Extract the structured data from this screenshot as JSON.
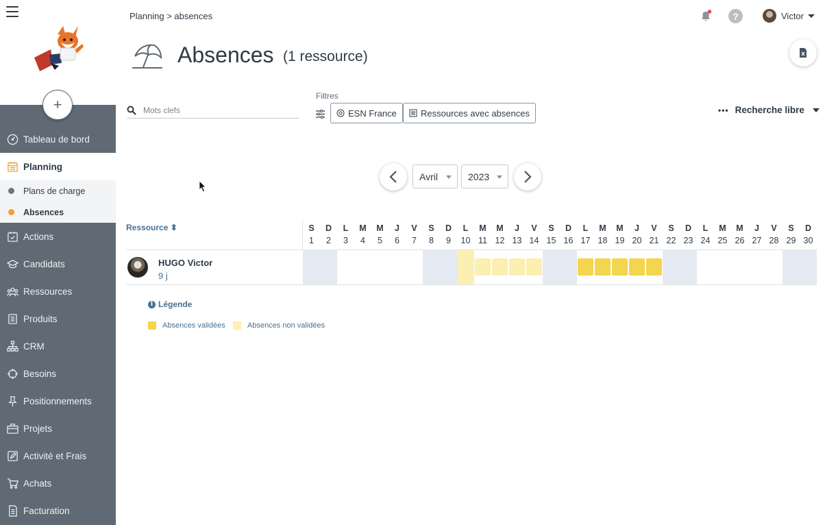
{
  "sidebar": {
    "add_label": "+",
    "items": [
      {
        "label": "Tableau de bord",
        "icon": "dashboard-icon"
      },
      {
        "label": "Planning",
        "icon": "calendar-icon"
      },
      {
        "label": "Actions",
        "icon": "actions-icon"
      },
      {
        "label": "Candidats",
        "icon": "graduation-cap-icon"
      },
      {
        "label": "Ressources",
        "icon": "people-icon"
      },
      {
        "label": "Produits",
        "icon": "list-icon"
      },
      {
        "label": "CRM",
        "icon": "org-chart-icon"
      },
      {
        "label": "Besoins",
        "icon": "target-icon"
      },
      {
        "label": "Positionnements",
        "icon": "pin-icon"
      },
      {
        "label": "Projets",
        "icon": "briefcase-icon"
      },
      {
        "label": "Activité et Frais",
        "icon": "edit-icon"
      },
      {
        "label": "Achats",
        "icon": "cart-icon"
      },
      {
        "label": "Facturation",
        "icon": "invoice-icon"
      }
    ],
    "sub_items": [
      {
        "label": "Plans de charge",
        "color": "#6b7680"
      },
      {
        "label": "Absences",
        "color": "#f0a030"
      }
    ]
  },
  "header": {
    "breadcrumb": "Planning > absences",
    "help": "?",
    "user_name": "Victor"
  },
  "page": {
    "title": "Absences",
    "subtitle": "(1 ressource)"
  },
  "search": {
    "placeholder": "Mots clefs",
    "value": ""
  },
  "filters": {
    "label": "Filtres",
    "chips": [
      "ESN France",
      "Ressources avec absences"
    ],
    "free_search": "Recherche libre"
  },
  "period": {
    "month": "Avril",
    "year": "2023"
  },
  "calendar": {
    "resource_header": "Ressource",
    "days": [
      {
        "l": "S",
        "n": "1",
        "we": true
      },
      {
        "l": "D",
        "n": "2",
        "we": true
      },
      {
        "l": "L",
        "n": "3"
      },
      {
        "l": "M",
        "n": "4"
      },
      {
        "l": "M",
        "n": "5"
      },
      {
        "l": "J",
        "n": "6"
      },
      {
        "l": "V",
        "n": "7"
      },
      {
        "l": "S",
        "n": "8",
        "we": true
      },
      {
        "l": "D",
        "n": "9",
        "we": true
      },
      {
        "l": "L",
        "n": "10",
        "state": "half"
      },
      {
        "l": "M",
        "n": "11",
        "state": "nv"
      },
      {
        "l": "M",
        "n": "12",
        "state": "nv"
      },
      {
        "l": "J",
        "n": "13",
        "state": "nv"
      },
      {
        "l": "V",
        "n": "14",
        "state": "nv"
      },
      {
        "l": "S",
        "n": "15",
        "we": true
      },
      {
        "l": "D",
        "n": "16",
        "we": true
      },
      {
        "l": "L",
        "n": "17",
        "state": "v"
      },
      {
        "l": "M",
        "n": "18",
        "state": "v"
      },
      {
        "l": "M",
        "n": "19",
        "state": "v"
      },
      {
        "l": "J",
        "n": "20",
        "state": "v"
      },
      {
        "l": "V",
        "n": "21",
        "state": "v"
      },
      {
        "l": "S",
        "n": "22",
        "we": true
      },
      {
        "l": "D",
        "n": "23",
        "we": true
      },
      {
        "l": "L",
        "n": "24"
      },
      {
        "l": "M",
        "n": "25"
      },
      {
        "l": "M",
        "n": "26"
      },
      {
        "l": "J",
        "n": "27"
      },
      {
        "l": "V",
        "n": "28"
      },
      {
        "l": "S",
        "n": "29",
        "we": true
      },
      {
        "l": "D",
        "n": "30",
        "we": true
      }
    ],
    "resource": {
      "name": "HUGO Victor",
      "days": "9 j"
    }
  },
  "legend": {
    "title": "Légende",
    "items": [
      {
        "label": "Absences validées",
        "color": "#f3d54e"
      },
      {
        "label": "Absences non validées",
        "color": "#fbefb2"
      }
    ]
  },
  "colors": {
    "accent": "#f0a030",
    "sidebar": "#5f6a74",
    "weekend": "#e5eaf2"
  }
}
